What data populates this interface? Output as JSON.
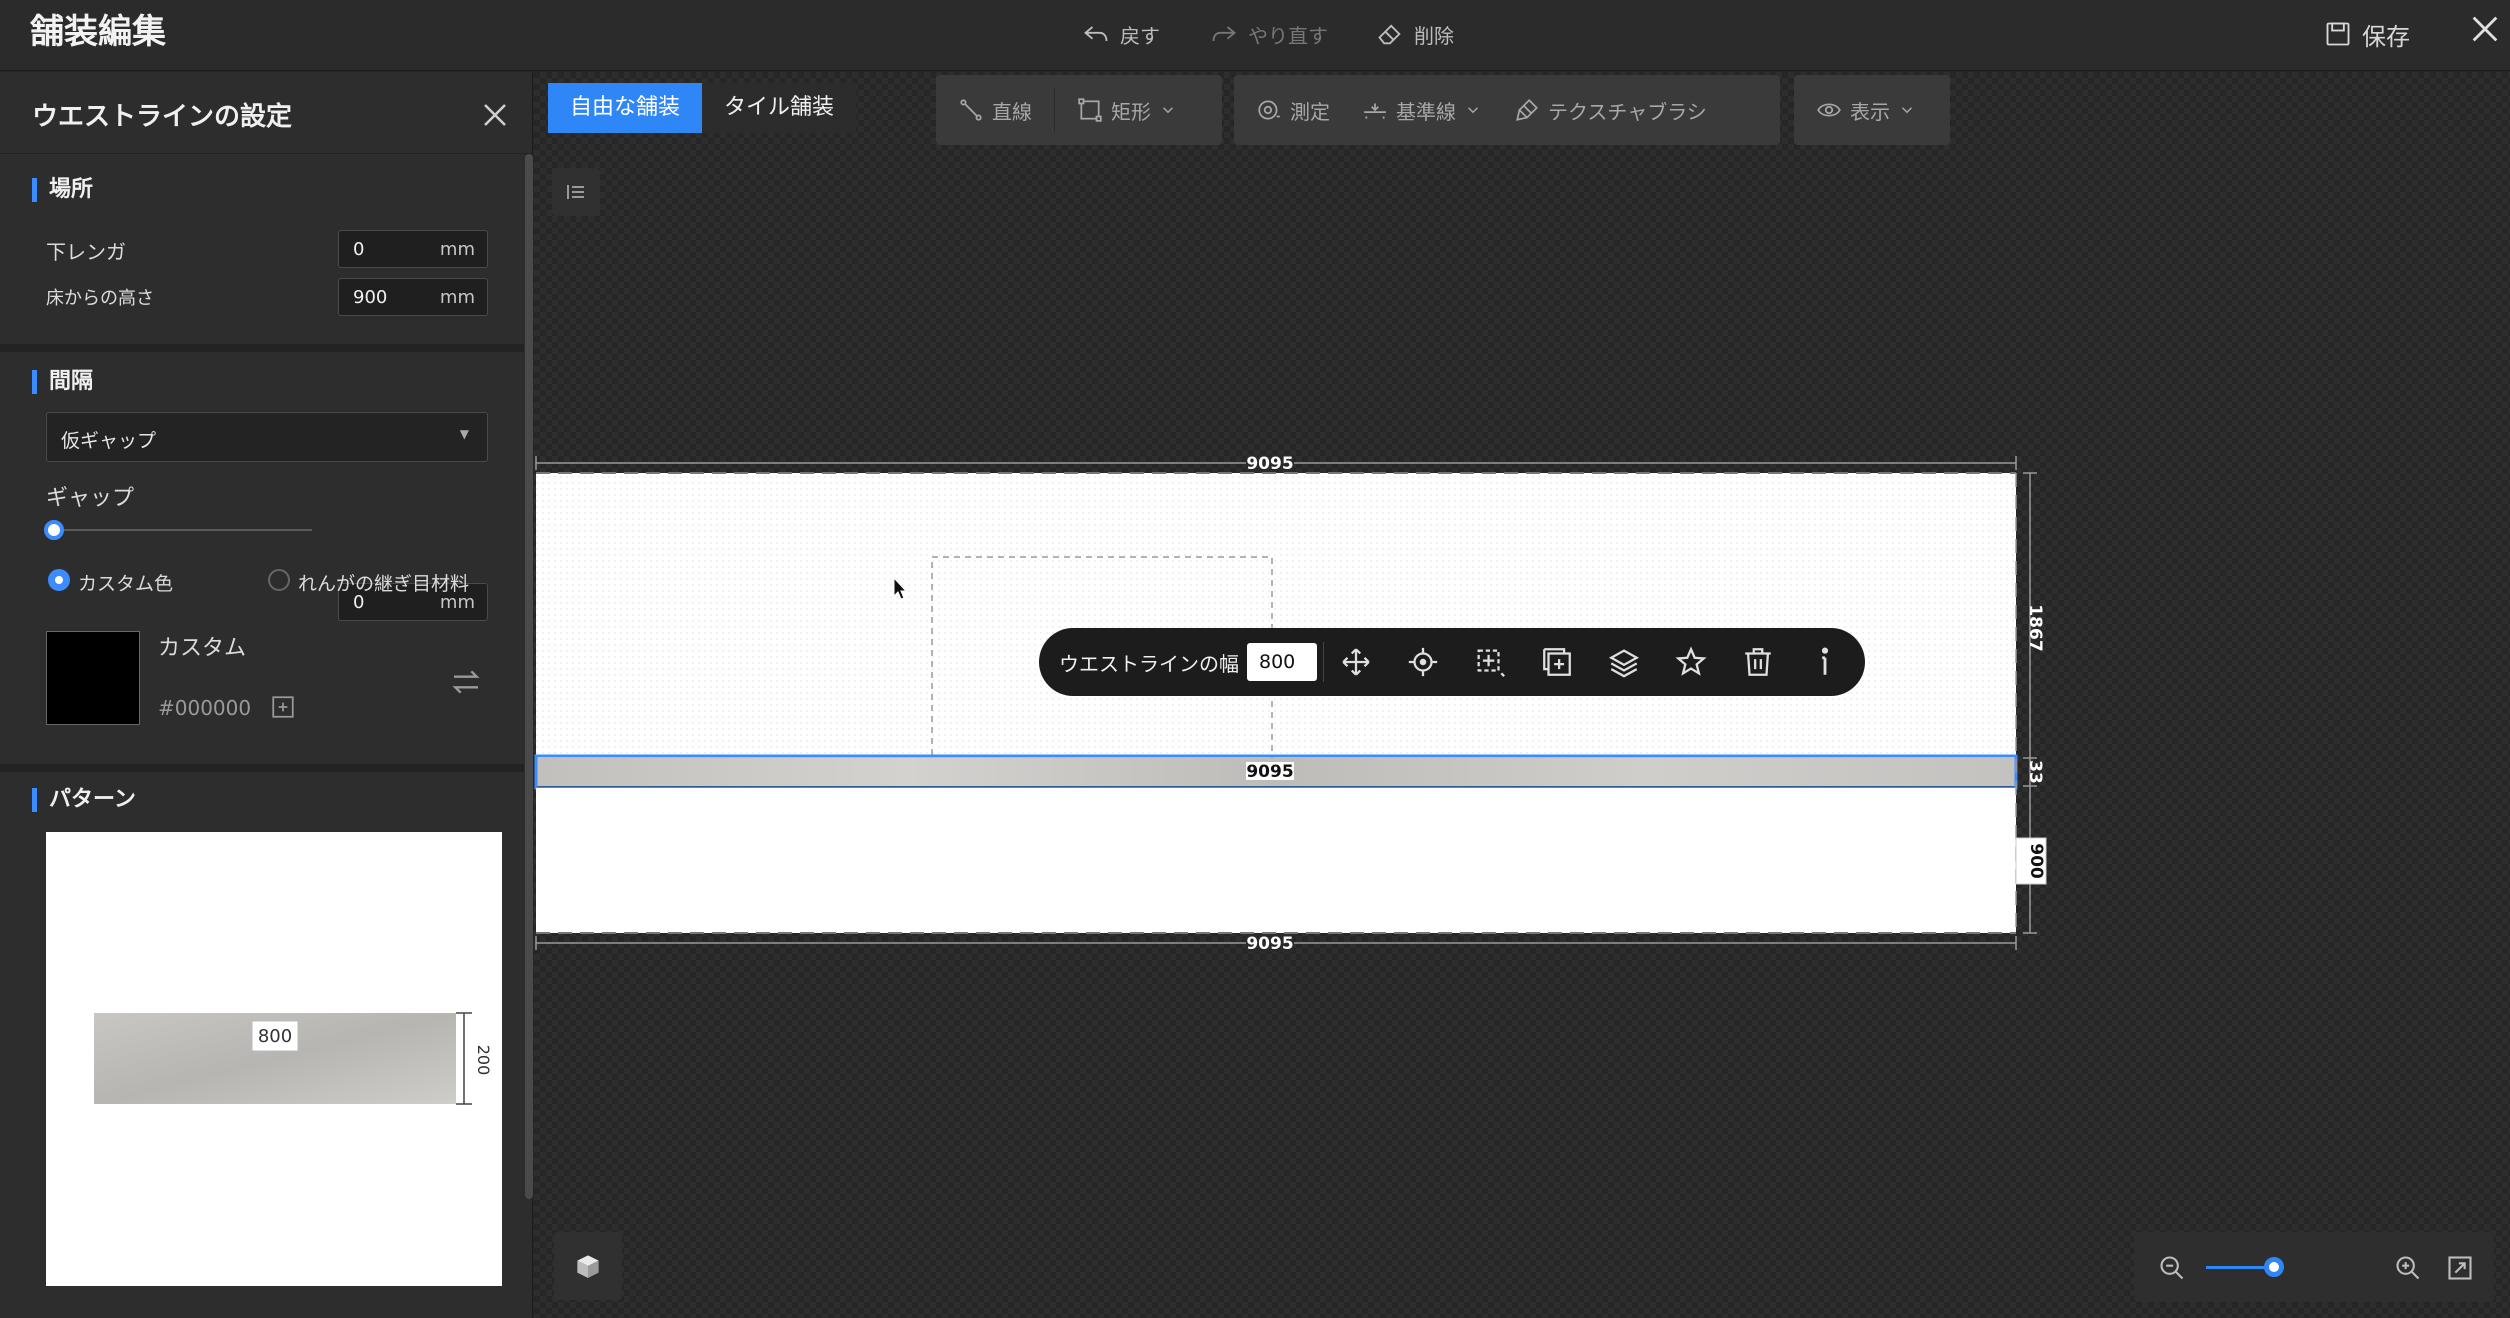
{
  "app": {
    "title": "舗装編集"
  },
  "header": {
    "undo_label": "戻す",
    "redo_label": "やり直す",
    "delete_label": "削除",
    "save_label": "保存"
  },
  "panel": {
    "title": "ウエストラインの設定",
    "location": {
      "title": "場所",
      "bottom_brick_label": "下レンガ",
      "bottom_brick_value": "0",
      "floor_height_label": "床からの高さ",
      "floor_height_value": "900",
      "unit": "mm"
    },
    "spacing": {
      "title": "間隔",
      "gap_type": "仮ギャップ",
      "gap_label": "ギャップ",
      "gap_value": "0",
      "unit": "mm",
      "slider_fraction": 0.0,
      "radio_custom_label": "カスタム色",
      "radio_joint_label": "れんがの継ぎ目材料",
      "color_name": "カスタム",
      "color_hex": "#000000"
    },
    "pattern": {
      "title": "パターン",
      "width": "800",
      "height": "200"
    }
  },
  "toolbar": {
    "free_paving": "自由な舗装",
    "tile_paving": "タイル舗装",
    "line": "直線",
    "rect": "矩形",
    "measure": "測定",
    "baseline": "基準線",
    "texture_brush": "テクスチャブラシ",
    "display": "表示"
  },
  "drawing": {
    "top_dim": "9095",
    "mid_dim": "9095",
    "bottom_dim": "9095",
    "right_dim_upper": "1867",
    "right_dim_band": "33",
    "right_dim_lower": "900"
  },
  "selection_bar": {
    "width_label": "ウエストラインの幅",
    "width_value": "800"
  },
  "zoom": {
    "level_fraction": 0.5
  },
  "colors": {
    "accent": "#2f86f6",
    "panel_bg": "#2d2d2d",
    "canvas_bg": "#262626"
  }
}
